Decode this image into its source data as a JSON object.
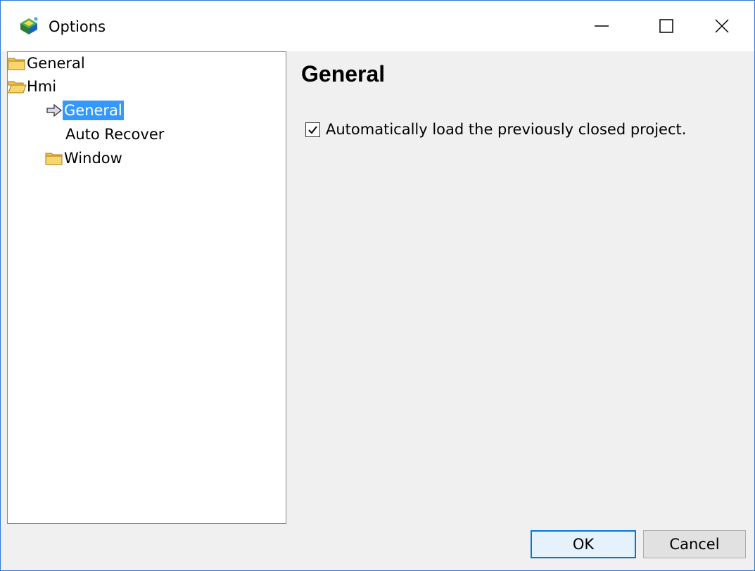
{
  "window": {
    "title": "Options",
    "accent_color": "#2b79d6"
  },
  "title_controls": {
    "minimize_icon": "minimize-icon",
    "maximize_icon": "maximize-icon",
    "close_icon": "close-icon"
  },
  "tree": {
    "items": [
      {
        "label": "General",
        "icon": "folder-closed-icon",
        "level": 0
      },
      {
        "label": "Hmi",
        "icon": "folder-open-icon",
        "level": 0
      },
      {
        "label": "General",
        "icon": "arrow-right-icon",
        "level": 1,
        "selected": true
      },
      {
        "label": "Auto Recover",
        "icon": "",
        "level": 1
      },
      {
        "label": "Window",
        "icon": "folder-closed-icon",
        "level": 1
      }
    ],
    "selection_color": "#3399ff"
  },
  "content": {
    "title": "General",
    "options": [
      {
        "label": "Automatically load the previously closed project.",
        "checked": true
      }
    ]
  },
  "buttons": {
    "ok_label": "OK",
    "cancel_label": "Cancel"
  }
}
